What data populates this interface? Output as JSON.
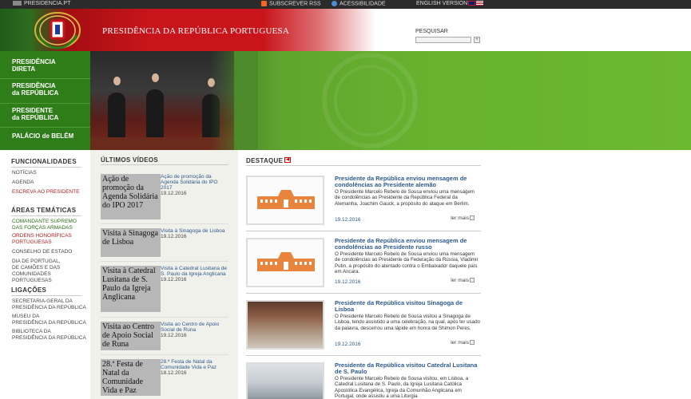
{
  "topbar": {
    "site": "PRESIDENCIA.PT",
    "rss": "SUBSCREVER RSS",
    "accessibility": "ACESSIBILIDADE",
    "english": "ENGLISH VERSION"
  },
  "header": {
    "title": "PRESIDÊNCIA DA REPÚBLICA PORTUGUESA",
    "search_label": "PESQUISAR",
    "search_button": "+"
  },
  "nav": [
    {
      "line1": "PRESIDÊNCIA",
      "line2": "DIRETA"
    },
    {
      "line1": "PRESIDÊNCIA",
      "line2": "da REPÚBLICA"
    },
    {
      "line1": "PRESIDENTE",
      "line2": "da REPÚBLICA"
    },
    {
      "line1": "PALÁCIO de BELÉM",
      "line2": ""
    }
  ],
  "sidebar": {
    "funcionalidades": {
      "title": "FUNCIONALIDADES",
      "links": [
        "NOTÍCIAS",
        "AGENDA",
        "ESCREVA AO PRESIDENTE"
      ]
    },
    "areas": {
      "title": "ÁREAS TEMÁTICAS",
      "links": [
        [
          "COMANDANTE SUPREMO",
          "DAS FORÇAS ARMADAS"
        ],
        [
          "ORDENS HONORÍFICAS",
          "PORTUGUESAS"
        ],
        [
          "CONSELHO DE ESTADO"
        ],
        [
          "DIA DE PORTUGAL,",
          "DE CAMÕES E DAS",
          "COMUNIDADES PORTUGUESAS"
        ]
      ]
    },
    "ligacoes": {
      "title": "LIGAÇÕES",
      "links": [
        [
          "SECRETARIA-GERAL DA",
          "PRESIDÊNCIA DA REPÚBLICA"
        ],
        [
          "MUSEU DA",
          "PRESIDÊNCIA DA REPÚBLICA"
        ],
        [
          "BIBLIOTECA DA",
          "PRESIDÊNCIA DA REPÚBLICA"
        ]
      ]
    }
  },
  "videos": {
    "title": "ÚLTIMOS VÍDEOS",
    "items": [
      {
        "thumb_alt": "Ação de promoção da Agenda Solidária do IPO 2017",
        "title": "Ação de promoção da Agenda Solidária do IPO 2017",
        "date": "19.12.2016"
      },
      {
        "thumb_alt": "Visita à Sinagoga de Lisboa",
        "title": "Visita à Sinagoga de Lisboa",
        "date": "19.12.2016"
      },
      {
        "thumb_alt": "Visita à Catedral Lusitana de S. Paulo da Igreja Anglicana",
        "title": "Visita à Catedral Lusitana de S. Paulo da Igreja Anglicana",
        "date": "19.12.2016"
      },
      {
        "thumb_alt": "Visita ao Centro de Apoio Social de Runa",
        "title": "Visita ao Centro de Apoio Social de Runa",
        "date": "19.12.2016"
      },
      {
        "thumb_alt": "28.ª Festa de Natal da Comunidade Vida e Paz",
        "title": "28.ª Festa de Natal da Comunidade Vida e Paz",
        "date": "18.12.2016"
      }
    ]
  },
  "destaque": {
    "title": "DESTAQUE",
    "more_label": "ler mais",
    "items": [
      {
        "title": "Presidente da República enviou mensagem de condolências ao Presidente alemão",
        "body": "O Presidente Marcelo Rebelo de Sousa enviou uma mensagem de condolências ao Presidente da República Federal da Alemanha, Joachim Gauck, a propósito do ataque em Berlim.",
        "date": "19.12.2016"
      },
      {
        "title": "Presidente da República enviou mensagem de condolências ao Presidente russo",
        "body": "O Presidente Marcelo Rebelo de Sousa enviou uma mensagem de condolências ao Presidente da Federação da Rússia, Vladimir Putin, a propósito do atentado contra o Embaixador daquele país em Ancara.",
        "date": "19.12.2016"
      },
      {
        "title": "Presidente da República visitou Sinagoga de Lisboa",
        "body": "O Presidente Marcelo Rebelo de Sousa visitou a Sinagoga de Lisboa, tendo assistido a uma celebração, na qual, após ter usado da palavra, descerrou uma lápide em honra de Shimon Peres.",
        "date": "19.12.2016"
      },
      {
        "title": "Presidente da República visitou Catedral Lusitana de S. Paulo",
        "body": "O Presidente Marcelo Rebelo de Sousa visitou, em Lisboa, a Catedral Lusitana de S. Paulo, da Igreja Lusitana Católica Apostólica Evangélica, Igreja da Comunhão Anglicana em Portugal, onde assistiu a uma Liturgia",
        "date": ""
      }
    ]
  },
  "colors": {
    "green": "#2e7d18",
    "red": "#c8141a",
    "link": "#2c5a8c"
  }
}
